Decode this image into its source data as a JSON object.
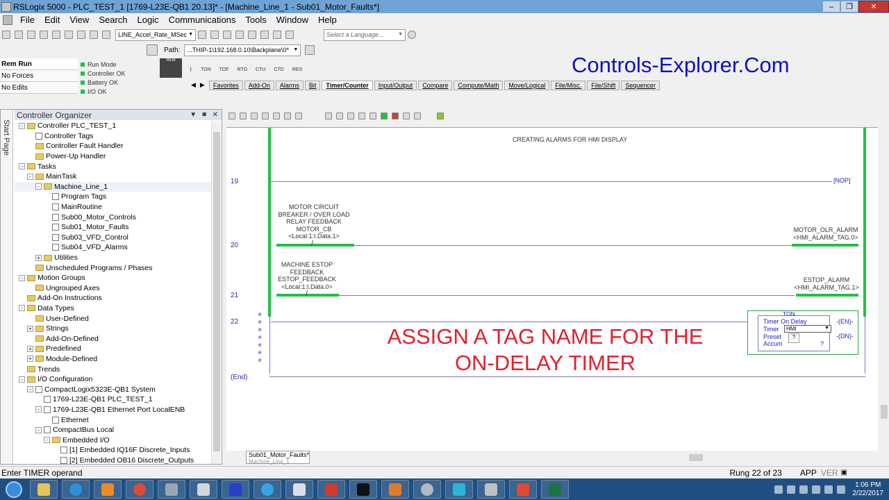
{
  "window": {
    "title": "RSLogix 5000 - PLC_TEST_1 [1769-L23E-QB1 20.13]* - [Machine_Line_1 - Sub01_Motor_Faults*]",
    "min": "–",
    "max": "❐",
    "close": "✕"
  },
  "menu": [
    "File",
    "Edit",
    "View",
    "Search",
    "Logic",
    "Communications",
    "Tools",
    "Window",
    "Help"
  ],
  "toolbar": {
    "routine_combo": "LINE_Accel_Rate_MSec",
    "language_combo": "Select a Language..."
  },
  "path": {
    "label": "Path:",
    "value": "...THIP-1\\192.168.0.10\\Backplane\\0*"
  },
  "status": {
    "mode": "Rem Run",
    "forces": "No Forces",
    "edits": "No Edits"
  },
  "leds": [
    {
      "label": "Run Mode",
      "color": "#21c143"
    },
    {
      "label": "Controller OK",
      "color": "#21c143"
    },
    {
      "label": "Battery OK",
      "color": "#21c143"
    },
    {
      "label": "I/O OK",
      "color": "#21c143"
    }
  ],
  "keyswitch": "REM",
  "palette": [
    "TON",
    "TOF",
    "RTO",
    "CTU",
    "CTD",
    "RES"
  ],
  "tabs": [
    "Favorites",
    "Add-On",
    "Alarms",
    "Bit",
    "Timer/Counter",
    "Input/Output",
    "Compare",
    "Compute/Math",
    "Move/Logical",
    "File/Misc.",
    "File/Shift",
    "Sequencer"
  ],
  "active_tab": "Timer/Counter",
  "brand": "Controls-Explorer.Com",
  "organizer": {
    "title": "Controller Organizer",
    "side_tab": "Start Page",
    "tree": [
      {
        "label": "Controller PLC_TEST_1",
        "level": 0,
        "exp": "-",
        "icon": "folder"
      },
      {
        "label": "Controller Tags",
        "level": 1,
        "exp": "",
        "icon": "file"
      },
      {
        "label": "Controller Fault Handler",
        "level": 1,
        "exp": "",
        "icon": "folder"
      },
      {
        "label": "Power-Up Handler",
        "level": 1,
        "exp": "",
        "icon": "folder"
      },
      {
        "label": "Tasks",
        "level": 0,
        "exp": "-",
        "icon": "folder"
      },
      {
        "label": "MainTask",
        "level": 1,
        "exp": "-",
        "icon": "folder"
      },
      {
        "label": "Machine_Line_1",
        "level": 2,
        "exp": "-",
        "icon": "folder"
      },
      {
        "label": "Program Tags",
        "level": 3,
        "exp": "",
        "icon": "file"
      },
      {
        "label": "MainRoutine",
        "level": 3,
        "exp": "",
        "icon": "file"
      },
      {
        "label": "Sub00_Motor_Controls",
        "level": 3,
        "exp": "",
        "icon": "file"
      },
      {
        "label": "Sub01_Motor_Faults",
        "level": 3,
        "exp": "",
        "icon": "file"
      },
      {
        "label": "Sub03_VFD_Control",
        "level": 3,
        "exp": "",
        "icon": "file"
      },
      {
        "label": "Sub04_VFD_Alarms",
        "level": 3,
        "exp": "",
        "icon": "file"
      },
      {
        "label": "Utilities",
        "level": 2,
        "exp": "+",
        "icon": "folder"
      },
      {
        "label": "Unscheduled Programs / Phases",
        "level": 1,
        "exp": "",
        "icon": "folder"
      },
      {
        "label": "Motion Groups",
        "level": 0,
        "exp": "-",
        "icon": "folder"
      },
      {
        "label": "Ungrouped Axes",
        "level": 1,
        "exp": "",
        "icon": "folder"
      },
      {
        "label": "Add-On Instructions",
        "level": 0,
        "exp": "",
        "icon": "folder"
      },
      {
        "label": "Data Types",
        "level": 0,
        "exp": "-",
        "icon": "folder"
      },
      {
        "label": "User-Defined",
        "level": 1,
        "exp": "",
        "icon": "folder"
      },
      {
        "label": "Strings",
        "level": 1,
        "exp": "+",
        "icon": "folder"
      },
      {
        "label": "Add-On-Defined",
        "level": 1,
        "exp": "",
        "icon": "folder"
      },
      {
        "label": "Predefined",
        "level": 1,
        "exp": "+",
        "icon": "folder"
      },
      {
        "label": "Module-Defined",
        "level": 1,
        "exp": "+",
        "icon": "folder"
      },
      {
        "label": "Trends",
        "level": 0,
        "exp": "",
        "icon": "folder"
      },
      {
        "label": "I/O Configuration",
        "level": 0,
        "exp": "-",
        "icon": "folder"
      },
      {
        "label": "CompactLogix5323E-QB1 System",
        "level": 1,
        "exp": "-",
        "icon": "file"
      },
      {
        "label": "1769-L23E-QB1 PLC_TEST_1",
        "level": 2,
        "exp": "",
        "icon": "file"
      },
      {
        "label": "1769-L23E-QB1 Ethernet Port LocalENB",
        "level": 2,
        "exp": "-",
        "icon": "file"
      },
      {
        "label": "Ethernet",
        "level": 3,
        "exp": "",
        "icon": "file"
      },
      {
        "label": "CompactBus Local",
        "level": 2,
        "exp": "-",
        "icon": "file"
      },
      {
        "label": "Embedded I/O",
        "level": 3,
        "exp": "-",
        "icon": "folder"
      },
      {
        "label": "[1] Embedded IQ16F Discrete_Inputs",
        "level": 4,
        "exp": "",
        "icon": "file"
      },
      {
        "label": "[2] Embedded OB16 Discrete_Outputs",
        "level": 4,
        "exp": "",
        "icon": "file"
      }
    ]
  },
  "ladder": {
    "rung_comment": "CREATING ALARMS FOR HMI DISPLAY",
    "rungs": [
      {
        "num": "19",
        "nop": "[NOP]"
      },
      {
        "num": "20",
        "xic_desc": [
          "MOTOR CIRCUIT",
          "BREAKER / OVER LOAD",
          "RELAY FEEDBACK",
          "MOTOR_CB"
        ],
        "xic_addr": "<Local:1:I.Data.1>",
        "ote_tag": "MOTOR_OLR_ALARM",
        "ote_addr": "<HMI_ALARM_TAG.0>"
      },
      {
        "num": "21",
        "xic_desc": [
          "MACHINE ESTOP",
          "FEEDBACK",
          "ESTOP_FEEDBACK"
        ],
        "xic_addr": "<Local:1:I.Data.0>",
        "ote_tag": "ESTOP_ALARM",
        "ote_addr": "<HMI_ALARM_TAG.1>"
      },
      {
        "num": "22"
      }
    ],
    "end_label": "(End)",
    "ton": {
      "title": "TON",
      "name": "Timer On Delay",
      "timer_label": "Timer",
      "timer_value": "HMI",
      "preset_label": "Preset",
      "preset_value": "?",
      "accum_label": "Accum",
      "accum_value": "?",
      "en": "EN",
      "dn": "DN"
    },
    "caption_line1": "ASSIGN A TAG NAME FOR THE",
    "caption_line2": "ON-DELAY TIMER",
    "e_marks": [
      "e",
      "e",
      "e",
      "e",
      "e",
      "e",
      "e"
    ]
  },
  "routine_tab": {
    "name": "Sub01_Motor_Faults*",
    "program": "Machine_Line_1"
  },
  "statusbar": {
    "message": "Enter TIMER operand",
    "rung": "Rung 22 of 23",
    "app": "APP",
    "ver": "VER"
  },
  "clock": {
    "time": "1:06 PM",
    "date": "2/22/2017"
  }
}
